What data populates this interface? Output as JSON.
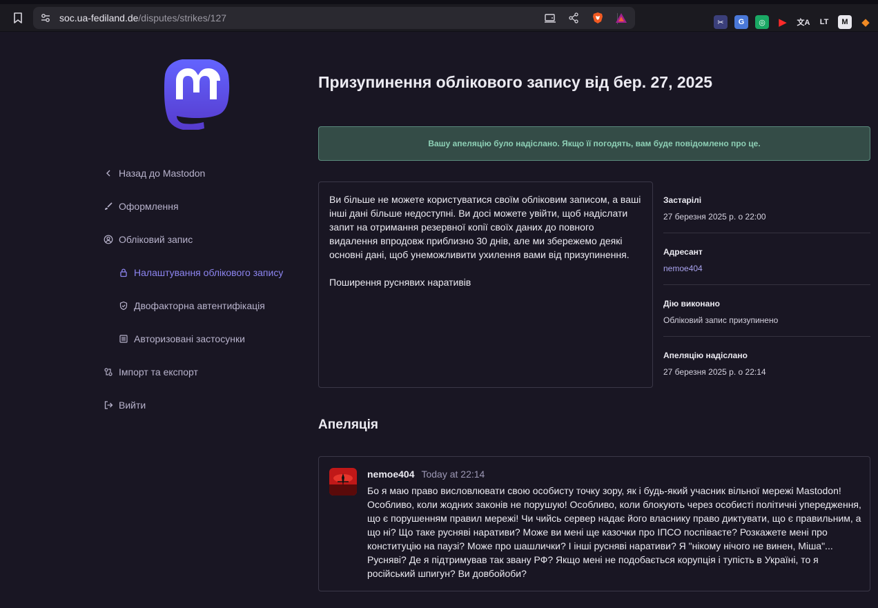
{
  "browser": {
    "url_host": "soc.ua-fediland.de",
    "url_path": "/disputes/strikes/127"
  },
  "sidebar": {
    "items": [
      {
        "label": "Назад до Mastodon",
        "icon": "chevron-left-icon"
      },
      {
        "label": "Оформлення",
        "icon": "brush-icon"
      },
      {
        "label": "Обліковий запис",
        "icon": "user-circle-icon"
      },
      {
        "label": "Налаштування облікового запису",
        "icon": "lock-icon",
        "active": true
      },
      {
        "label": "Двофакторна автентифікація",
        "icon": "shield-icon"
      },
      {
        "label": "Авторизовані застосунки",
        "icon": "list-icon"
      },
      {
        "label": "Імпорт та експорт",
        "icon": "import-export-icon"
      },
      {
        "label": "Вийти",
        "icon": "logout-icon"
      }
    ]
  },
  "main": {
    "title": "Призупинення облікового запису від бер. 27, 2025",
    "notice": "Вашу апеляцію було надіслано. Якщо її погодять, вам буде повідомлено про це.",
    "strike_text": "Ви більше не можете користуватися своїм обліковим записом, а ваші інші дані більше недоступні. Ви досі можете увійти, щоб надіслати запит на отримання резервної копії своїх даних до повного видалення впродовж приблизно 30 днів, але ми збережемо деякі основні дані, щоб унеможливити ухилення вами від призупинення.",
    "strike_reason": "Поширення руснявих наративів",
    "meta": [
      {
        "label": "Застарілі",
        "value": "27 березня 2025 р. о 22:00"
      },
      {
        "label": "Адресант",
        "value": "nemoe404"
      },
      {
        "label": "Дію виконано",
        "value": "Обліковий запис призупинено"
      },
      {
        "label": "Апеляцію надіслано",
        "value": "27 березня 2025 р. о 22:14"
      }
    ],
    "appeal_heading": "Апеляція",
    "appeal": {
      "author": "nemoe404",
      "time": "Today at 22:14",
      "text": "Бо я маю право висловлювати свою особисту точку зору, як і будь-який учасник вільної мережі Mastodon! Особливо, коли жодних законів не порушую! Особливо, коли блокують через особисті політичні упередження, що є порушенням правил мережі! Чи чийсь сервер надає його власнику право диктувати, що є правильним, а що ні? Що таке русняві наративи? Може ви мені ще казочки про ІПСО поспіваєте? Розкажете мені про конституцію на паузі?  Може про шашлички? І інші русняві наративи? Я \"нікому нічого не винен, Міша\"... Русняві? Де я підтримував так звану РФ? Якщо мені не подобається корупція і тупість в Україні, то я російський шпигун? Ви довбойоби?"
    }
  }
}
